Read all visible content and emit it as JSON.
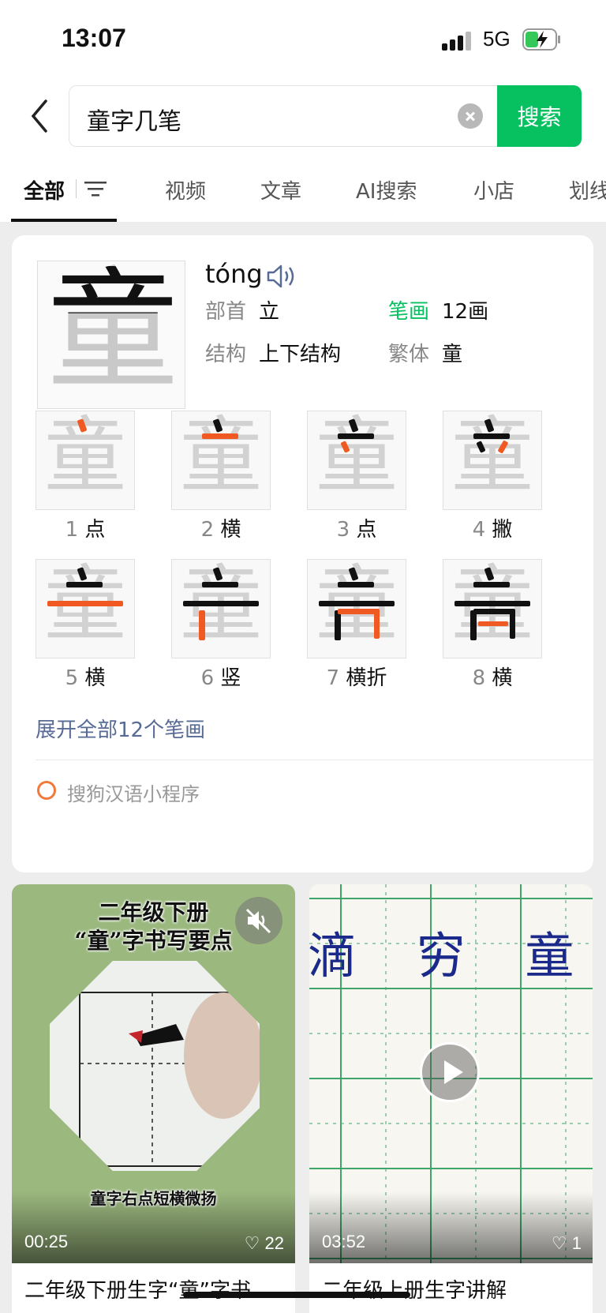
{
  "status_bar": {
    "time": "13:07",
    "network": "5G"
  },
  "search": {
    "query": "童字几笔",
    "button_label": "搜索"
  },
  "tabs": [
    {
      "label": "全部"
    },
    {
      "label": "视频"
    },
    {
      "label": "文章"
    },
    {
      "label": "AI搜索"
    },
    {
      "label": "小店"
    },
    {
      "label": "划线"
    }
  ],
  "character": {
    "glyph": "童",
    "pinyin": "tóng",
    "radical_label": "部首",
    "radical": "立",
    "strokes_label": "笔画",
    "strokes": "12画",
    "structure_label": "结构",
    "structure": "上下结构",
    "traditional_label": "繁体",
    "traditional": "童"
  },
  "strokes": [
    {
      "num": "1",
      "name": "点"
    },
    {
      "num": "2",
      "name": "横"
    },
    {
      "num": "3",
      "name": "点"
    },
    {
      "num": "4",
      "name": "撇"
    },
    {
      "num": "5",
      "name": "横"
    },
    {
      "num": "6",
      "name": "竖"
    },
    {
      "num": "7",
      "name": "横折"
    },
    {
      "num": "8",
      "name": "横"
    }
  ],
  "expand_label": "展开全部12个笔画",
  "source_label": "搜狗汉语小程序",
  "videos": [
    {
      "overlay_line1": "二年级下册",
      "overlay_line2": "“童”字书写要点",
      "overlay_bottom": "童字右点短横微扬",
      "duration": "00:25",
      "likes": "22",
      "title": "二年级下册生字“童”字书"
    },
    {
      "overlay_chars": "滴 穷 童",
      "duration": "03:52",
      "likes": "1",
      "title": "二年级上册生字讲解"
    }
  ],
  "colors": {
    "accent_green": "#07c160",
    "link_blue": "#576b95",
    "stroke_highlight": "#f05a22"
  }
}
